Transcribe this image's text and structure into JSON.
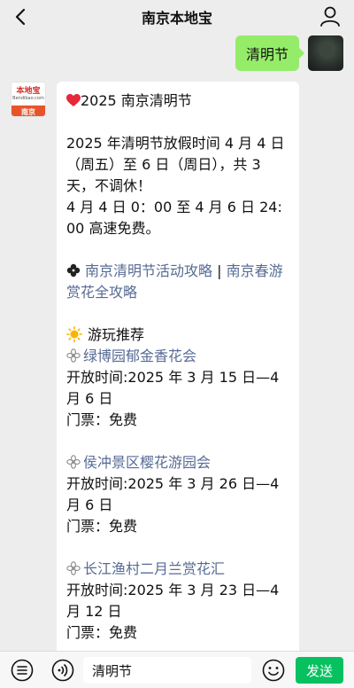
{
  "header": {
    "title": "南京本地宝"
  },
  "outgoing": {
    "text": "清明节"
  },
  "bot": {
    "logo_name": "本地宝",
    "logo_url": "Bendibao.com",
    "logo_city": "南京"
  },
  "message": {
    "heading": "2025 南京清明节",
    "holiday": "2025 年清明节放假时间 4 月 4 日（周五）至 6 日（周日），共 3 天，不调休！",
    "toll": "4 月 4 日 0：00 至 4 月 6 日 24:00 高速免费。",
    "link1": "南京清明节活动攻略",
    "separator": " | ",
    "link2": "南京春游赏花全攻略",
    "rec_title": "游玩推荐",
    "events": [
      {
        "name": "绿博园郁金香花会",
        "time": "开放时间:2025 年 3 月 15 日—4 月 6 日",
        "ticket": "门票：免费"
      },
      {
        "name": "侯冲景区樱花游园会",
        "time": "开放时间:2025 年 3 月 26 日—4 月 6 日",
        "ticket": "门票：免费"
      },
      {
        "name": "长江渔村二月兰赏花汇",
        "time": "开放时间:2025 年 3 月 23 日—4 月 12 日",
        "ticket": "门票：免费"
      }
    ]
  },
  "input": {
    "value": "清明节"
  },
  "send": {
    "label": "发送"
  },
  "colors": {
    "send_green": "#07c160",
    "bubble_green": "#95ec69",
    "link_blue": "#576b95"
  }
}
